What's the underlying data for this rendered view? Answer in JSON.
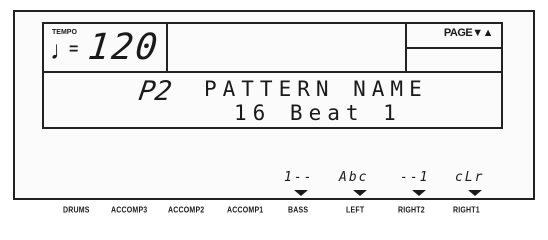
{
  "tempo": {
    "label": "TEMPO",
    "note_icon": "♩",
    "equals": "=",
    "value": "120"
  },
  "page": {
    "label": "PAGE",
    "arrows": "▼▲"
  },
  "pattern": {
    "code": "P2",
    "title": "PATTERN NAME",
    "name": "16 Beat 1"
  },
  "function_codes": [
    "1--",
    "Abc",
    "--1",
    "cLr"
  ],
  "function_buttons": [
    "BASS",
    "LEFT",
    "RIGHT2",
    "RIGHT1"
  ],
  "track_labels": [
    "DRUMS",
    "ACCOMP3",
    "ACCOMP2",
    "ACCOMP1"
  ]
}
